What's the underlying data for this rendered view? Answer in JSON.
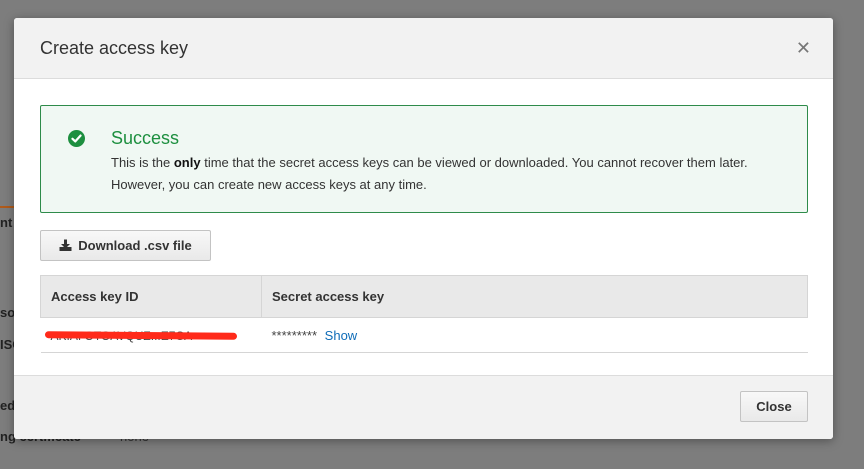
{
  "background": {
    "fragments": [
      "nt",
      "so",
      "ISC",
      "ed",
      "ng certificate",
      "none"
    ]
  },
  "modal": {
    "title": "Create access key",
    "close_icon": "close-icon",
    "success": {
      "icon": "check-circle-icon",
      "title": "Success",
      "message_before": "This is the ",
      "message_emphasis": "only",
      "message_after": " time that the secret access keys can be viewed or downloaded. You cannot recover them later. However, you can create new access keys at any time.",
      "color": "#1d8f3f"
    },
    "download_button": {
      "icon": "download-icon",
      "label": "Download .csv file"
    },
    "table": {
      "headers": [
        "Access key ID",
        "Secret access key"
      ],
      "rows": [
        {
          "access_key_id": "AKIAI OTOAVQUZ...E7CA",
          "secret_mask": "*********",
          "show_label": "Show"
        }
      ]
    },
    "footer": {
      "close_label": "Close"
    }
  }
}
